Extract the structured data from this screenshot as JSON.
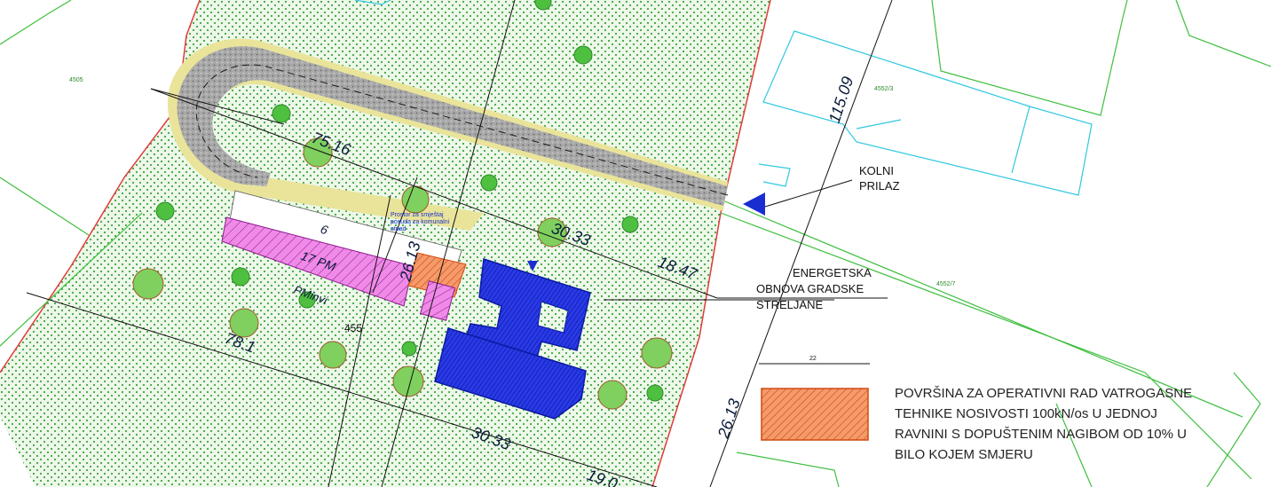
{
  "labels": {
    "access": [
      "KOLNI",
      "PRILAZ"
    ],
    "project": [
      "ENERGETSKA",
      "OBNOVA GRADSKE",
      "STRELJANE"
    ],
    "container_note": [
      "Prostor za smještaj",
      "posuda za komunalni",
      "otpad"
    ],
    "parking_main": "17 PM",
    "parking_disabled": "PMinvi",
    "parcel_no": "455"
  },
  "dimensions": {
    "d1": "75.16",
    "d2": "30.33",
    "d3": "18.47",
    "d4": "26.13",
    "d5": "78.1",
    "d6": "30.33",
    "d7": "19.0",
    "d8": "115.09",
    "d9": "26.13",
    "d10": "22",
    "parking_width": "6"
  },
  "legend": {
    "lines": [
      "POVRŠINA ZA OPERATIVNI RAD VATROGASNE",
      "TEHNIKE NOSIVOSTI 100kN/os U JEDNOJ",
      "RAVNINI S DOPUŠTENIM NAGIBOM OD 10% U",
      "BILO KOJEM SMJERU"
    ],
    "swatch_color": "#f26b2e"
  },
  "parcels": {
    "p1": "4505",
    "p2": "4552/3",
    "p3": "4552/7"
  },
  "colors": {
    "green_area": "#eaf6e4",
    "building": "#1a2dd0",
    "road": "#9a9a9a",
    "boundary": "#e03b3b",
    "parking": "#e87ae0",
    "cyan": "#30c8e0"
  }
}
